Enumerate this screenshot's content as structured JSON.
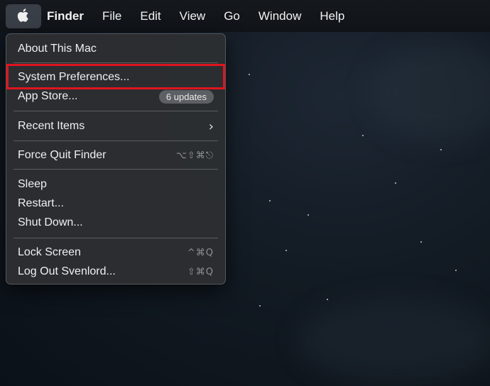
{
  "menubar": {
    "apple_icon": "apple-logo-icon",
    "items": [
      "Finder",
      "File",
      "Edit",
      "View",
      "Go",
      "Window",
      "Help"
    ]
  },
  "apple_menu": {
    "about": "About This Mac",
    "system_preferences": "System Preferences...",
    "app_store": "App Store...",
    "app_store_badge": "6 updates",
    "recent_items": "Recent Items",
    "force_quit": "Force Quit Finder",
    "force_quit_shortcut": "⌥⇧⌘⎋",
    "sleep": "Sleep",
    "restart": "Restart...",
    "shut_down": "Shut Down...",
    "lock_screen": "Lock Screen",
    "lock_screen_shortcut": "^⌘Q",
    "log_out": "Log Out Svenlord...",
    "log_out_shortcut": "⇧⌘Q"
  },
  "colors": {
    "highlight_border": "#e0141e",
    "menu_background": "#2c2e32",
    "desktop_background": "#121a23"
  }
}
